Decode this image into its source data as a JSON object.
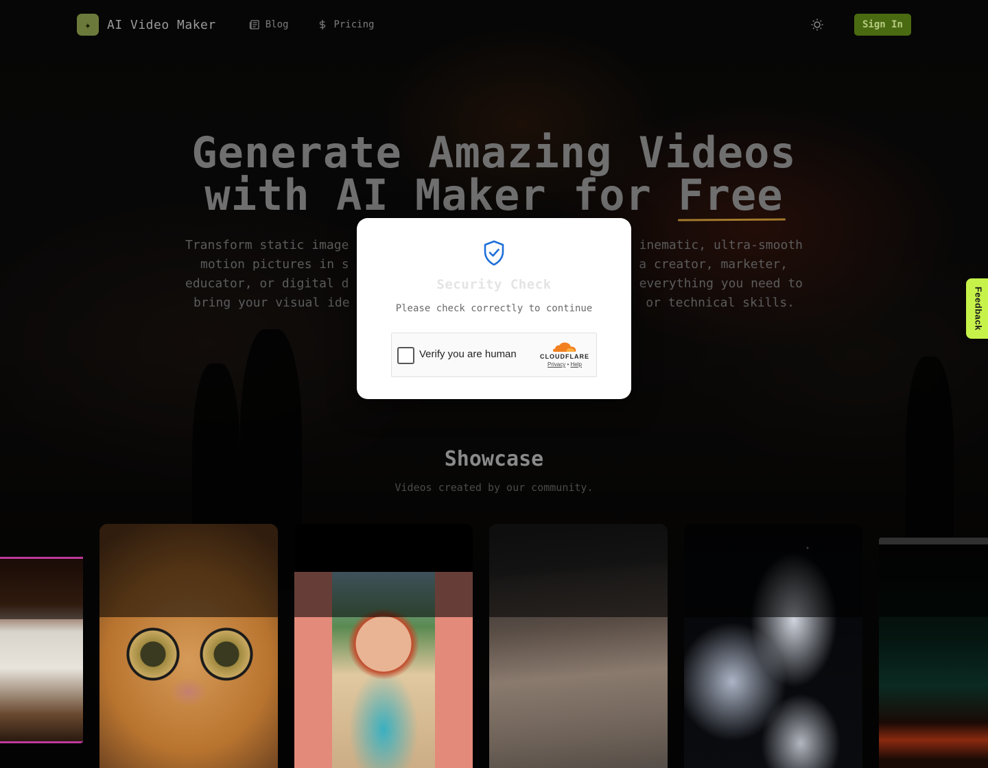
{
  "header": {
    "logo_icon": "sparkle-icon",
    "app_name": "AI Video Maker",
    "nav": [
      {
        "label": "Blog",
        "icon": "newspaper-icon"
      },
      {
        "label": "Pricing",
        "icon": "dollar-icon"
      }
    ],
    "theme_icon": "sun-icon",
    "signin_label": "Sign In"
  },
  "hero": {
    "title_line1": "Generate Amazing Videos",
    "title_line2_prefix": "with AI Maker for ",
    "title_line2_accent": "Free",
    "subtitle_line1": "Transform static image",
    "subtitle_line1_right": "inematic, ultra-smooth",
    "subtitle_line2": "motion pictures in s",
    "subtitle_line2_right": "a creator, marketer,",
    "subtitle_line3": "educator, or digital d",
    "subtitle_line3_right": "everything you need to",
    "subtitle_line4": "bring your visual ide",
    "subtitle_line4_right": "or technical skills."
  },
  "showcase": {
    "title": "Showcase",
    "subtitle": "Videos created by our community."
  },
  "modal": {
    "icon": "shield-check-icon",
    "title": "Security Check",
    "subtitle": "Please check correctly to continue",
    "captcha": {
      "label": "Verify you are human",
      "brand": "CLOUDFLARE",
      "privacy": "Privacy",
      "separator": "•",
      "help": "Help"
    }
  },
  "feedback": {
    "label": "Feedback"
  },
  "colors": {
    "accent_green": "#4a6a12",
    "feedback_green": "#c6f24a",
    "cloudflare_orange": "#f38020"
  }
}
